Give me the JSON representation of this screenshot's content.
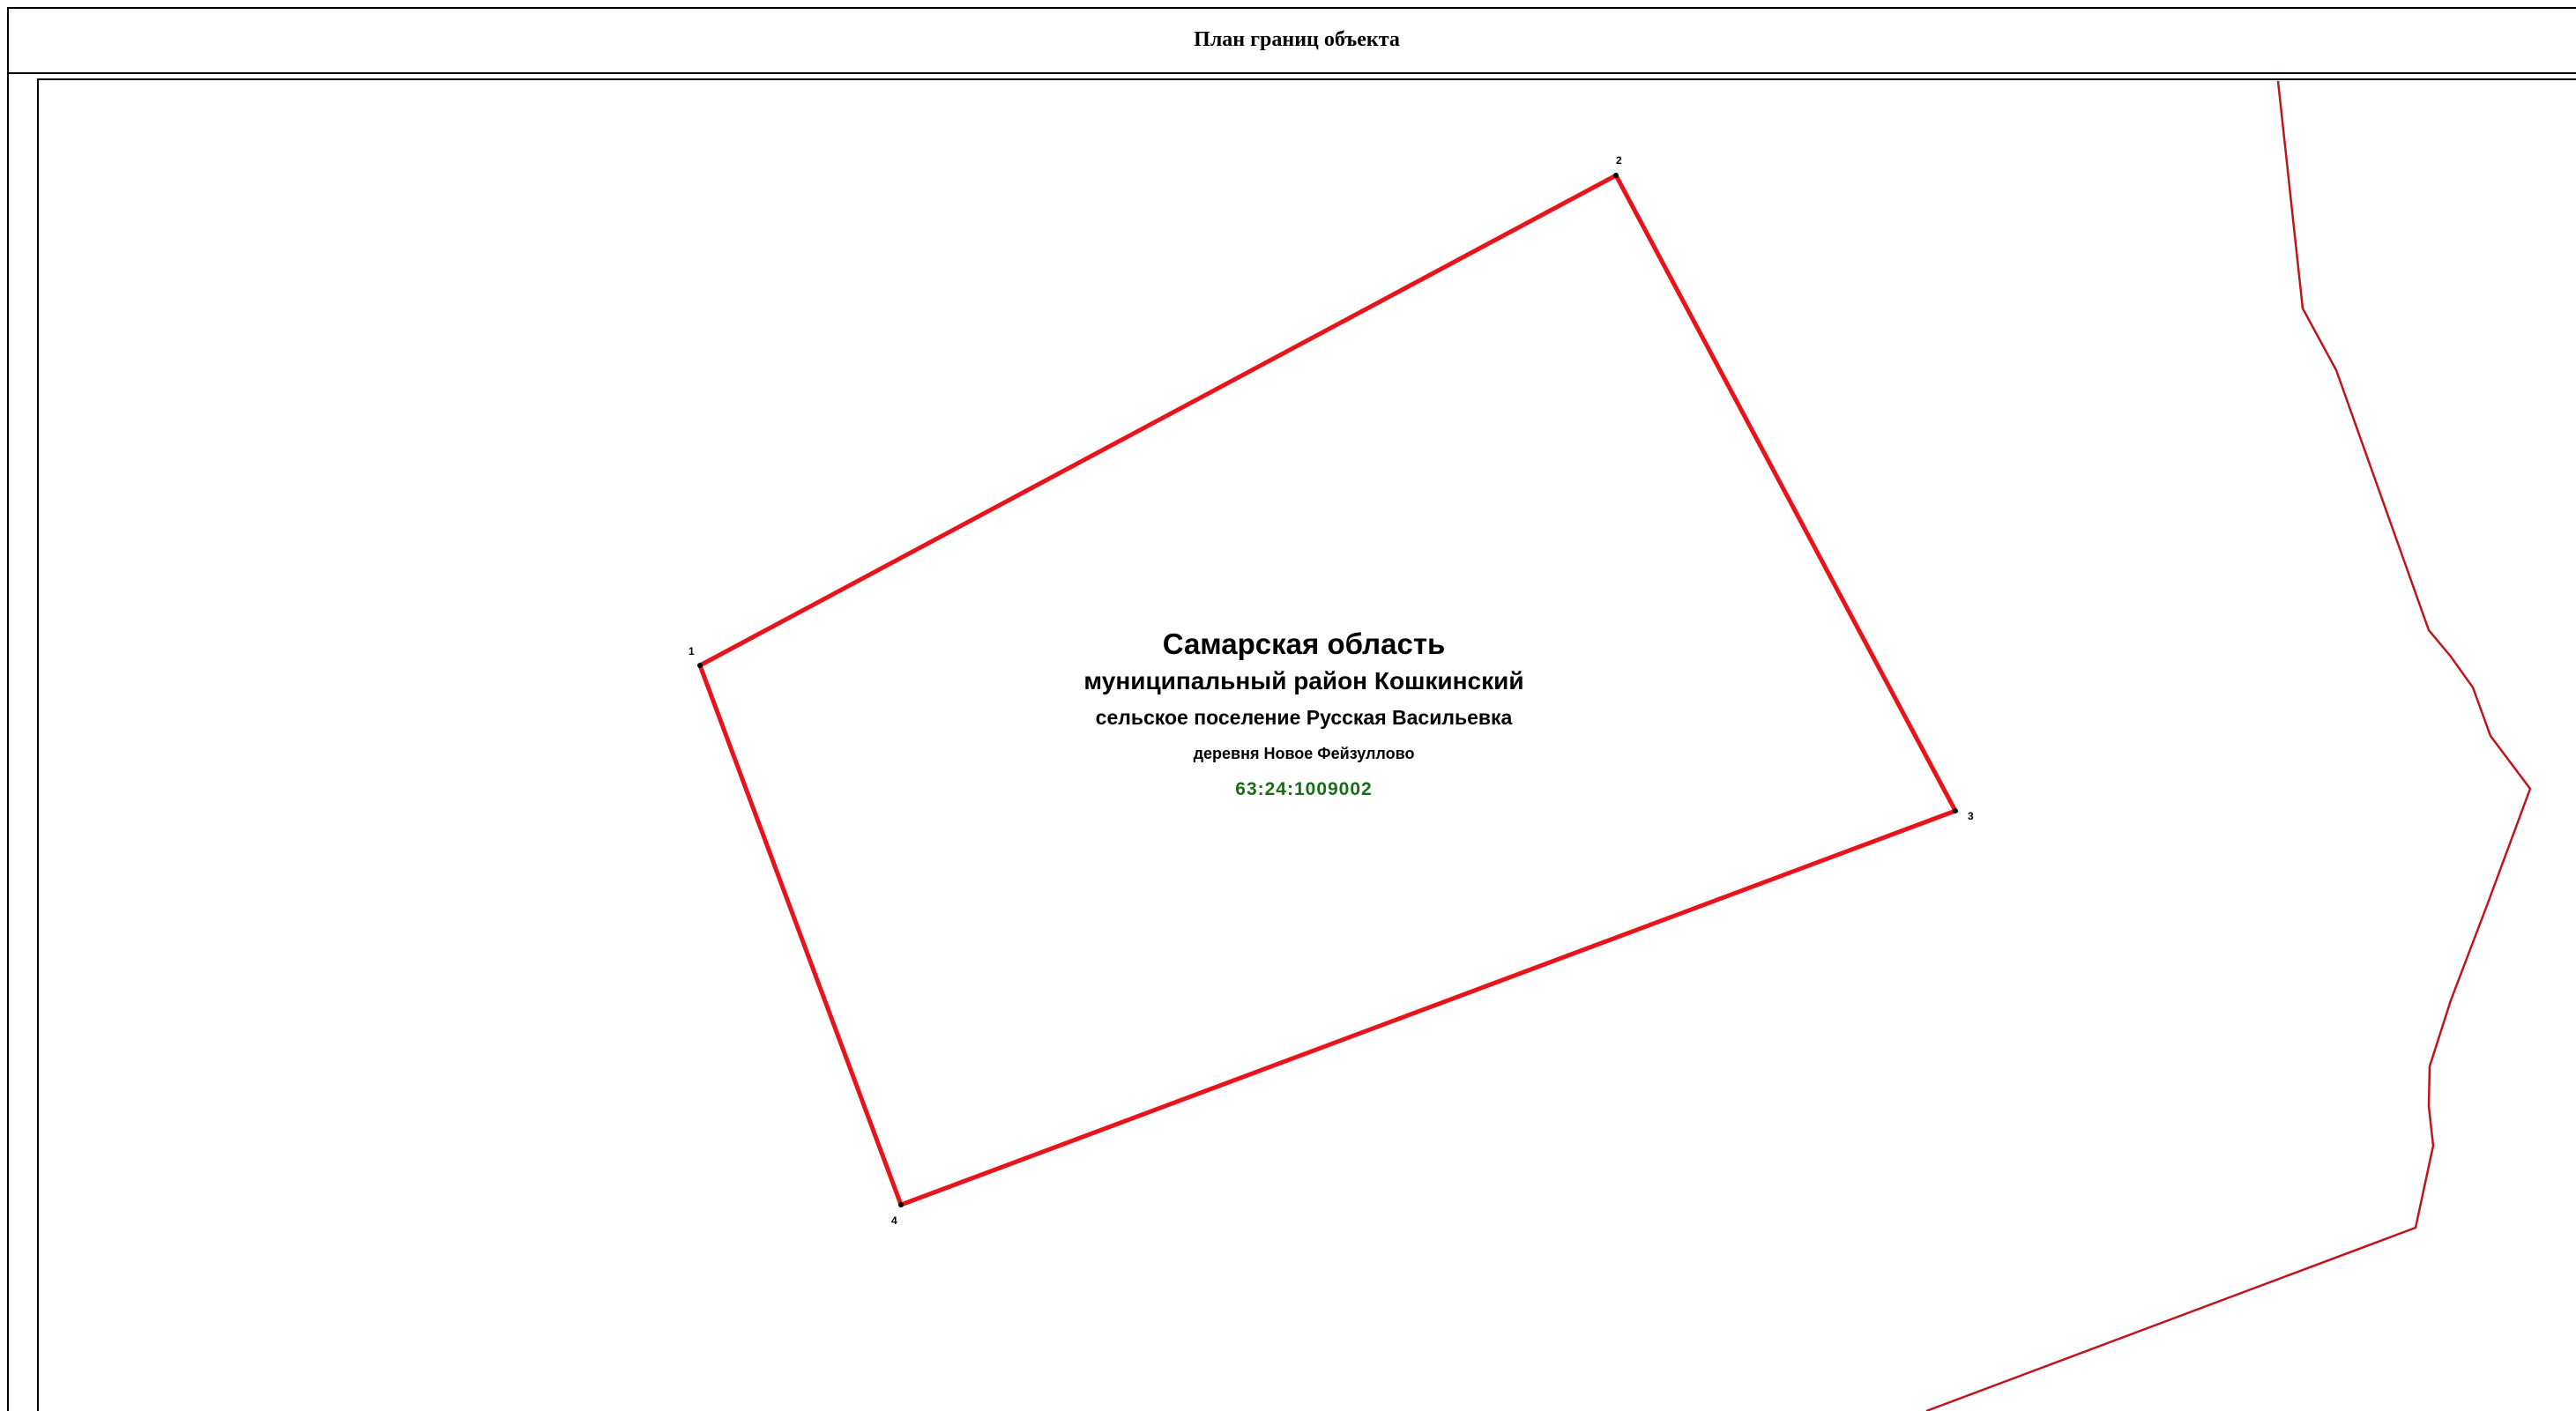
{
  "title": "План границ объекта",
  "parcel": {
    "vertices": [
      {
        "label": "1"
      },
      {
        "label": "2"
      },
      {
        "label": "3"
      },
      {
        "label": "4"
      }
    ],
    "boundary_color": "#e8141b"
  },
  "adjacent_boundary_color": "#c0141a",
  "labels": {
    "region": "Самарская область",
    "district": "муниципальный район Кошкинский",
    "settlement": "сельское поселение Русская Васильевка",
    "village": "деревня Новое Фейзуллово",
    "cadastral_number": "63:24:1009002"
  },
  "cadastral_color": "#1a6b1a"
}
